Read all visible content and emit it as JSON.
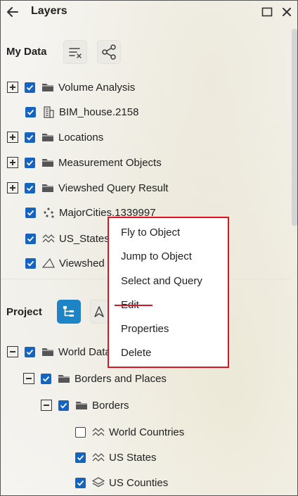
{
  "window": {
    "title": "Layers",
    "back_icon": "arrow-left-icon",
    "maximize_icon": "maximize-icon",
    "close_icon": "close-icon"
  },
  "my_data": {
    "heading": "My Data",
    "tools": [
      "clear-list-icon",
      "share-icon"
    ],
    "items": [
      {
        "label": "Volume Analysis",
        "expander": "plus",
        "checked": true,
        "icon": "folder-icon"
      },
      {
        "label": "BIM_house.2158",
        "expander": null,
        "checked": true,
        "icon": "building-icon"
      },
      {
        "label": "Locations",
        "expander": "plus",
        "checked": true,
        "icon": "folder-icon"
      },
      {
        "label": "Measurement Objects",
        "expander": "plus",
        "checked": true,
        "icon": "folder-icon"
      },
      {
        "label": "Viewshed Query Result",
        "expander": "plus",
        "checked": true,
        "icon": "folder-icon"
      },
      {
        "label": "MajorCities.1339997",
        "expander": null,
        "checked": true,
        "icon": "points-icon"
      },
      {
        "label": "US_States",
        "expander": null,
        "checked": true,
        "icon": "line-layer-icon"
      },
      {
        "label": "Viewshed",
        "expander": null,
        "checked": true,
        "icon": "viewshed-icon"
      }
    ]
  },
  "project": {
    "heading": "Project",
    "tools": [
      "tree-view-icon",
      "navigation-icon"
    ],
    "items": [
      {
        "label": "World Data",
        "expander": "minus",
        "checked": true,
        "icon": "folder-icon"
      },
      {
        "label": "Borders and Places",
        "expander": "minus",
        "checked": true,
        "icon": "folder-icon"
      },
      {
        "label": "Borders",
        "expander": "minus",
        "checked": true,
        "icon": "folder-icon"
      },
      {
        "label": "World Countries",
        "expander": null,
        "checked": false,
        "icon": "line-layer-icon"
      },
      {
        "label": "US States",
        "expander": null,
        "checked": true,
        "icon": "line-layer-icon"
      },
      {
        "label": "US Counties",
        "expander": null,
        "checked": true,
        "icon": "stack-layer-icon"
      }
    ]
  },
  "context_menu": {
    "items": [
      "Fly to Object",
      "Jump to Object",
      "Select and Query",
      "Edit",
      "Properties",
      "Delete"
    ]
  },
  "colors": {
    "accent": "#1e84c6",
    "checkbox": "#1565c0",
    "highlight": "#e0141e"
  }
}
